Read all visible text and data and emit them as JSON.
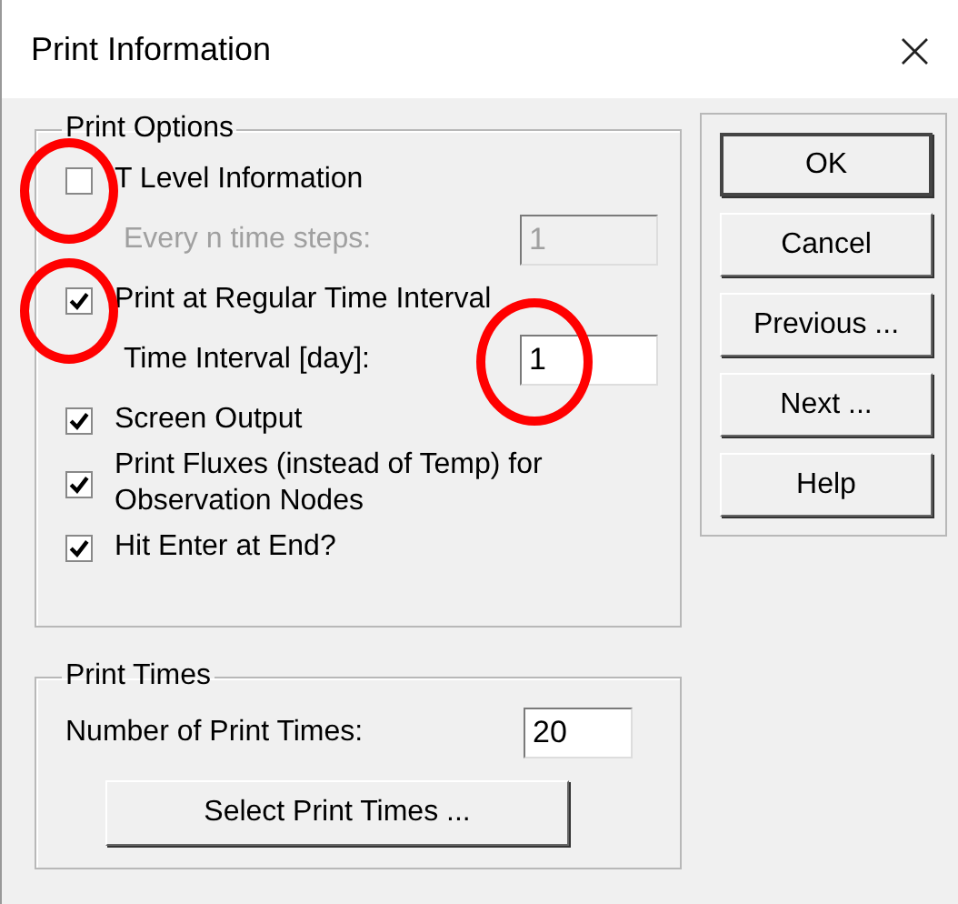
{
  "window": {
    "title": "Print Information",
    "close": "×"
  },
  "print_options": {
    "title": "Print Options",
    "items": [
      {
        "kind": "checkbox",
        "label": "T Level Information",
        "checked": false,
        "circled": true
      },
      {
        "kind": "field",
        "label": "Every n time steps:",
        "value": "1",
        "disabled": true
      },
      {
        "kind": "checkbox",
        "label": "Print at Regular Time Interval",
        "checked": true,
        "circled": true
      },
      {
        "kind": "field",
        "label": "Time Interval [day]:",
        "value": "1",
        "disabled": false,
        "circled": true
      },
      {
        "kind": "checkbox",
        "label": "Screen Output",
        "checked": true
      },
      {
        "kind": "checkbox",
        "label": "Print Fluxes (instead of Temp) for Observation Nodes",
        "checked": true
      },
      {
        "kind": "checkbox",
        "label": "Hit Enter at End?",
        "checked": true
      }
    ]
  },
  "print_times": {
    "title": "Print Times",
    "field_label": "Number of Print Times:",
    "field_value": "20",
    "button": "Select Print Times ..."
  },
  "buttons": [
    {
      "label": "OK",
      "default": true
    },
    {
      "label": "Cancel",
      "default": false
    },
    {
      "label": "Previous ...",
      "default": false
    },
    {
      "label": "Next ...",
      "default": false
    },
    {
      "label": "Help",
      "default": false
    }
  ]
}
